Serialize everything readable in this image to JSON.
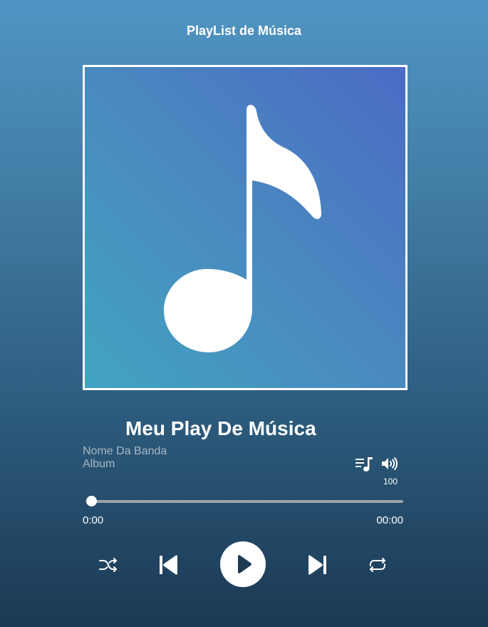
{
  "app": {
    "title": "PlayList de Música"
  },
  "cover": {
    "icon": "music-note-icon",
    "gradient": [
      "#4b6bc5",
      "#4a86c0",
      "#42a4c0"
    ],
    "border_color": "#ffffff"
  },
  "track": {
    "title": "Meu Play De Música",
    "band": "Nome Da Banda",
    "album": "Album"
  },
  "side_controls": {
    "playlist_icon": "playlist-icon",
    "volume_icon": "volume-icon",
    "volume_value": "100"
  },
  "progress": {
    "current_time": "0:00",
    "total_time": "00:00",
    "fraction": 0
  },
  "controls": {
    "shuffle_icon": "shuffle-icon",
    "previous_icon": "skip-previous-icon",
    "play_icon": "play-icon",
    "next_icon": "skip-next-icon",
    "repeat_icon": "repeat-icon"
  },
  "colors": {
    "background_top": "#4f95c4",
    "background_bottom": "#1b3953",
    "secondary_text": "#a9b7c4",
    "track": "#9aa4ad",
    "accent": "#ffffff"
  }
}
